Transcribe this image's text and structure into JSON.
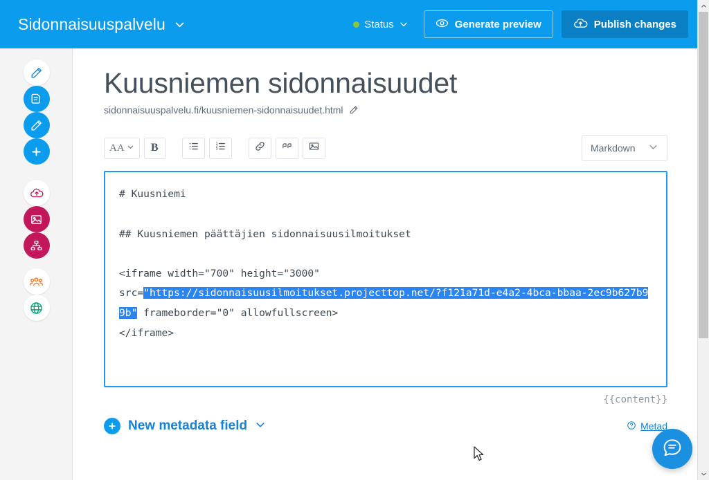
{
  "header": {
    "brand": "Sidonnaisuuspalvelu",
    "brand_chevron_icon": "chevron-down-icon",
    "status_label": "Status",
    "status_dot_color": "#8dc63f",
    "status_chevron_icon": "chevron-down-icon",
    "generate_preview_label": "Generate preview",
    "generate_preview_icon": "eye-icon",
    "publish_label": "Publish changes",
    "publish_icon": "cloud-upload-icon",
    "background_color": "#0b9ced",
    "publish_button_color": "#0a7fc4"
  },
  "sidebar": {
    "items": [
      {
        "name": "sidebar-item-edit",
        "icon": "pencil-icon",
        "style": "white",
        "color": "#1283d6"
      },
      {
        "name": "sidebar-item-page",
        "icon": "document-icon",
        "style": "blue",
        "color": "#ffffff"
      },
      {
        "name": "sidebar-item-edit-content",
        "icon": "pencil-icon",
        "style": "blue",
        "color": "#ffffff"
      },
      {
        "name": "sidebar-item-add",
        "icon": "plus-icon",
        "style": "blue",
        "color": "#ffffff"
      },
      {
        "name": "sidebar-item-publish",
        "icon": "cloud-upload-icon",
        "style": "white",
        "color": "#c2185b"
      },
      {
        "name": "sidebar-item-media",
        "icon": "image-icon",
        "style": "pink",
        "color": "#ffffff"
      },
      {
        "name": "sidebar-item-sitemap",
        "icon": "sitemap-icon",
        "style": "pink",
        "color": "#ffffff"
      },
      {
        "name": "sidebar-item-users",
        "icon": "people-icon",
        "style": "white",
        "color": "#f4721f"
      },
      {
        "name": "sidebar-item-site",
        "icon": "globe-icon",
        "style": "white",
        "color": "#00a67d"
      }
    ]
  },
  "page": {
    "title": "Kuusniemen sidonnaisuudet",
    "url": "sidonnaisuuspalvelu.fi/kuusniemen-sidonnaisuudet.html",
    "url_edit_icon": "pencil-icon"
  },
  "toolbar": {
    "buttons": [
      {
        "name": "font-size-button",
        "label": "AA",
        "icon": "chevron-down-icon"
      },
      {
        "name": "bold-button",
        "label": "B",
        "icon": ""
      },
      {
        "name": "bullet-list-button",
        "label": "",
        "icon": "bullet-list-icon"
      },
      {
        "name": "numbered-list-button",
        "label": "",
        "icon": "numbered-list-icon"
      },
      {
        "name": "link-button",
        "label": "",
        "icon": "link-icon"
      },
      {
        "name": "quote-button",
        "label": "",
        "icon": "quote-icon"
      },
      {
        "name": "image-button",
        "label": "",
        "icon": "image-icon"
      }
    ],
    "format_select_value": "Markdown",
    "format_select_icon": "chevron-down-icon"
  },
  "editor": {
    "border_color": "#2196f3",
    "selection_color": "#2a85f2",
    "lines": {
      "l1": "# Kuusniemi",
      "l2": "",
      "l3": "## Kuusniemen päättäjien sidonnaisuusilmoitukset",
      "l4": "",
      "l5a": "<iframe width=\"700\" height=\"3000\"",
      "l6a": "src=",
      "l6_selected": "\"https://sidonnaisuusilmoitukset.projecttop.net/?f121a71d-e4a2-4bca-bbaa-2ec9b627b99b\"",
      "l6b": " frameborder=\"0\" allowfullscreen>",
      "l7": "</iframe>"
    },
    "content_token": "{{content}}"
  },
  "footer": {
    "new_metadata_label": "New metadata field",
    "new_metadata_plus_icon": "plus-icon",
    "new_metadata_chevron_icon": "chevron-down-icon",
    "metadata_link_label": "Metad",
    "metadata_link_icon": "help-circle-icon"
  },
  "widgets": {
    "chat_icon": "chat-bubble-icon",
    "chat_color": "#1b8fe0"
  },
  "scrollbar": {
    "up_icon": "chevron-up-icon",
    "down_icon": "chevron-down-icon"
  }
}
